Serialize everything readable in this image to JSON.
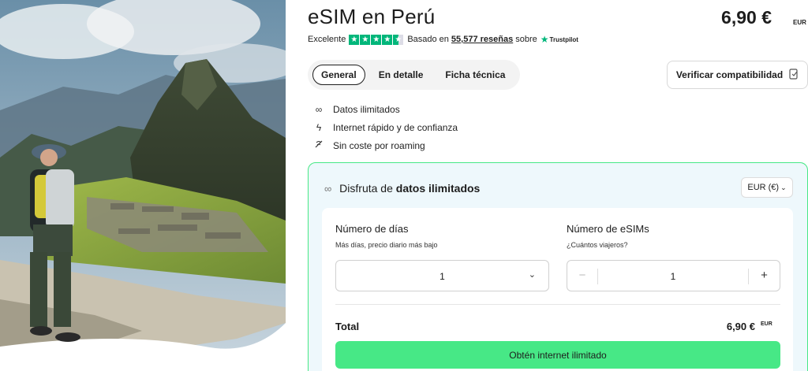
{
  "product": {
    "title": "eSIM en Perú",
    "price": "6,90 €",
    "price_currency": "EUR"
  },
  "rating": {
    "label": "Excelente",
    "based_on": "Basado en",
    "reviews": "55,577 reseñas",
    "on": "sobre",
    "platform": "Trustpilot",
    "stars": 4.5,
    "star_color": "#00b67a"
  },
  "tabs": [
    {
      "label": "General",
      "active": true
    },
    {
      "label": "En detalle",
      "active": false
    },
    {
      "label": "Ficha técnica",
      "active": false
    }
  ],
  "verify_button": {
    "label": "Verificar compatibilidad",
    "icon": "phone-check-icon"
  },
  "features": [
    {
      "icon": "infinity-icon",
      "label": "Datos ilimitados"
    },
    {
      "icon": "lightning-icon",
      "label": "Internet rápido y de confianza"
    },
    {
      "icon": "no-roaming-icon",
      "label": "Sin coste por roaming"
    }
  ],
  "plan_card": {
    "heading_prefix": "Disfruta de",
    "heading_bold": "datos ilimitados",
    "currency_select": "EUR (€)",
    "days": {
      "label": "Número de días",
      "hint": "Más días, precio diario más bajo",
      "value": "1"
    },
    "esims": {
      "label": "Número de eSIMs",
      "hint": "¿Cuántos viajeros?",
      "value": "1"
    },
    "total_label": "Total",
    "total_value": "6,90 €",
    "total_currency": "EUR",
    "cta_label": "Obtén internet ilimitado",
    "accent": "#47e886"
  }
}
